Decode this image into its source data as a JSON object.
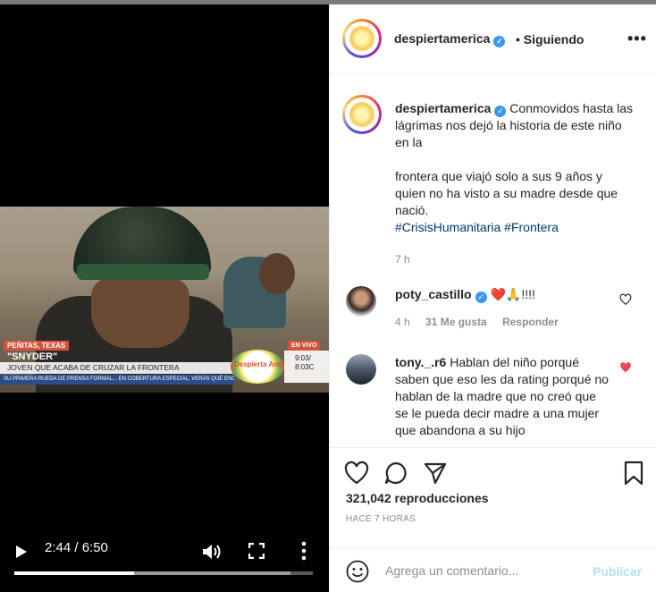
{
  "video": {
    "overlay": {
      "location": "PEÑITAS, TEXAS",
      "name": "\"SNYDER\"",
      "headline": "JOVEN QUE ACABA DE CRUZAR LA FRONTERA",
      "ticker": "SU PRIMERA RUEDA DE PRENSA FORMAL... EN COBERTURA ESPECIAL, VERÁS QUÉ ENCONT",
      "live": "EN VIVO",
      "logo_text": "Despierta América",
      "clock_et": "9:03/",
      "clock_ct": "8:03C"
    },
    "controls": {
      "time": "2:44 / 6:50",
      "progress": 0.401,
      "buffered": 0.925
    }
  },
  "post": {
    "header": {
      "username": "despiertamerica",
      "separator": "•",
      "follow_state": "Siguiendo",
      "more": "•••"
    },
    "caption": {
      "username": "despiertamerica",
      "line1": "Conmovidos hasta las lágrimas nos dejó la historia de este niño en la",
      "line2": "frontera que viajó solo a sus 9 años y quien no ha visto a su madre desde que nació.",
      "tag1": "#CrisisHumanitaria",
      "tag2": "#Frontera",
      "time": "7 h"
    },
    "comments": [
      {
        "username": "poty_castillo",
        "text": "❤️🙏!!!!",
        "time": "4 h",
        "likes": "31 Me gusta",
        "reply": "Responder",
        "liked": false
      },
      {
        "username": "tony._.r6",
        "text": "Hablan del niño porqué saben que eso les da rating porqué no hablan de la madre que no creó que se le pueda decir madre a una mujer que abandona a su hijo",
        "liked": true
      }
    ],
    "views": "321,042 reproducciones",
    "ago": "HACE 7 HORAS",
    "add_comment": {
      "placeholder": "Agrega un comentario...",
      "publish": "Publicar"
    }
  },
  "colors": {
    "accent": "#3897f0",
    "like_red": "#ed4956",
    "publish_disabled": "#b2dffc",
    "muted": "#8e8e8e"
  },
  "icons": [
    "play-icon",
    "volume-icon",
    "fullscreen-icon",
    "more-vertical-icon",
    "heart-icon",
    "comment-icon",
    "share-icon",
    "bookmark-icon",
    "emoji-icon",
    "verified-icon"
  ]
}
